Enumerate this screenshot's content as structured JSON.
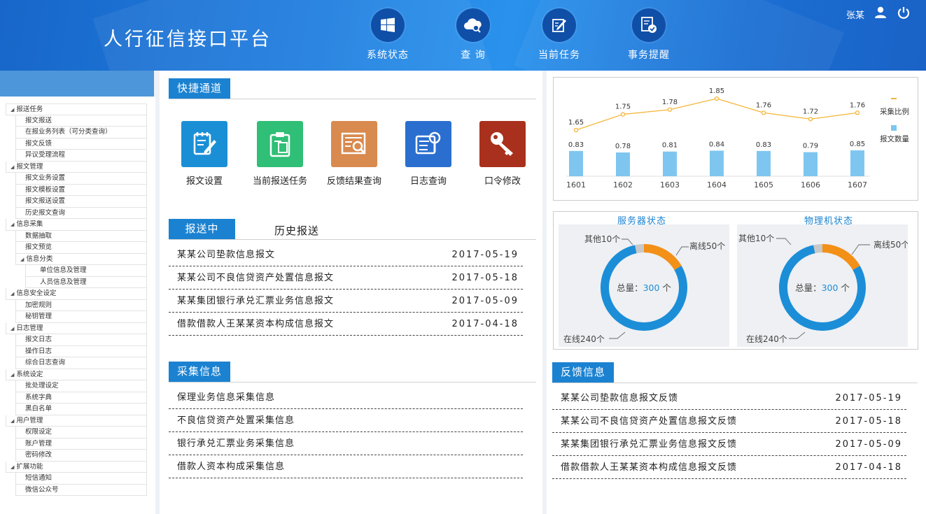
{
  "header": {
    "title": "人行征信接口平台",
    "nav": [
      {
        "label": "系统状态",
        "icon": "windows-icon"
      },
      {
        "label": "查 询",
        "icon": "cloud-search-icon"
      },
      {
        "label": "当前任务",
        "icon": "edit-document-icon"
      },
      {
        "label": "事务提醒",
        "icon": "clock-check-icon"
      }
    ],
    "user_name": "张某"
  },
  "sidebar": {
    "items": [
      {
        "label": "报送任务",
        "level": 0
      },
      {
        "label": "报文报送",
        "level": 1
      },
      {
        "label": "在报业务列表（可分类查询）",
        "level": 1
      },
      {
        "label": "报文反馈",
        "level": 1
      },
      {
        "label": "异议受理流程",
        "level": 1
      },
      {
        "label": "报文管理",
        "level": 0
      },
      {
        "label": "报文业务设置",
        "level": 1
      },
      {
        "label": "报文模板设置",
        "level": 1
      },
      {
        "label": "报文报送设置",
        "level": 1
      },
      {
        "label": "历史报文查询",
        "level": 1
      },
      {
        "label": "信息采集",
        "level": 0
      },
      {
        "label": "数据抽取",
        "level": 1
      },
      {
        "label": "报文预览",
        "level": 1
      },
      {
        "label": "信息分类",
        "level": 1,
        "group": true
      },
      {
        "label": "单位信息及管理",
        "level": 2
      },
      {
        "label": "人员信息及管理",
        "level": 2
      },
      {
        "label": "信息安全设定",
        "level": 0
      },
      {
        "label": "加密规则",
        "level": 1
      },
      {
        "label": "秘钥管理",
        "level": 1
      },
      {
        "label": "日志管理",
        "level": 0
      },
      {
        "label": "报文日志",
        "level": 1
      },
      {
        "label": "操作日志",
        "level": 1
      },
      {
        "label": "综合日志查询",
        "level": 1
      },
      {
        "label": "系统设定",
        "level": 0
      },
      {
        "label": "批处理设定",
        "level": 1
      },
      {
        "label": "系统字典",
        "level": 1
      },
      {
        "label": "黑白名单",
        "level": 1
      },
      {
        "label": "用户管理",
        "level": 0
      },
      {
        "label": "权限设定",
        "level": 1
      },
      {
        "label": "账户管理",
        "level": 1
      },
      {
        "label": "密码修改",
        "level": 1
      },
      {
        "label": "扩展功能",
        "level": 0
      },
      {
        "label": "短信通知",
        "level": 1
      },
      {
        "label": "微信公众号",
        "level": 1
      }
    ]
  },
  "quick": {
    "title": "快捷通道",
    "items": [
      {
        "label": "报文设置",
        "color": "#1b8fd6"
      },
      {
        "label": "当前报送任务",
        "color": "#2fbf76"
      },
      {
        "label": "反馈结果查询",
        "color": "#d98a4e"
      },
      {
        "label": "日志查询",
        "color": "#2a6fcf"
      },
      {
        "label": "口令修改",
        "color": "#a8301c"
      }
    ]
  },
  "reports": {
    "tab_active": "报送中",
    "tab_inactive": "历史报送",
    "rows": [
      {
        "text": "某某公司垫款信息报文",
        "date": "2017-05-19"
      },
      {
        "text": "某某公司不良信贷资产处置信息报文",
        "date": "2017-05-18"
      },
      {
        "text": "某某集团银行承兑汇票业务信息报文",
        "date": "2017-05-09"
      },
      {
        "text": "借款借款人王某某资本构成信息报文",
        "date": "2017-04-18"
      }
    ]
  },
  "collect": {
    "title": "采集信息",
    "rows": [
      "保理业务信息采集信息",
      "不良信贷资产处置采集信息",
      "银行承兑汇票业务采集信息",
      "借款人资本构成采集信息"
    ]
  },
  "feedback": {
    "title": "反馈信息",
    "rows": [
      {
        "text": "某某公司垫款信息报文反馈",
        "date": "2017-05-19"
      },
      {
        "text": "某某公司不良信贷资产处置信息报文反馈",
        "date": "2017-05-18"
      },
      {
        "text": "某某集团银行承兑汇票业务信息报文反馈",
        "date": "2017-05-09"
      },
      {
        "text": "借款借款人王某某资本构成信息报文反馈",
        "date": "2017-04-18"
      }
    ]
  },
  "chart_data": [
    {
      "type": "bar+line",
      "categories": [
        "1601",
        "1602",
        "1603",
        "1604",
        "1605",
        "1606",
        "1607"
      ],
      "series": [
        {
          "name": "采集比例",
          "type": "line",
          "values": [
            1.65,
            1.75,
            1.78,
            1.85,
            1.76,
            1.72,
            1.76
          ],
          "labels": [
            "1.65",
            "1.75",
            "1.78",
            "1.85",
            "1.76",
            "1.72",
            "1.76"
          ],
          "color": "#f5b534"
        },
        {
          "name": "报文数量",
          "type": "bar",
          "values": [
            0.83,
            0.78,
            0.81,
            0.84,
            0.83,
            0.79,
            0.85
          ],
          "labels": [
            "0.83",
            "0.78",
            "0.81",
            "0.84",
            "0.83",
            "0.79",
            "0.85"
          ],
          "color": "#7ec6f0"
        }
      ],
      "legend_position": "right"
    },
    {
      "type": "pie",
      "title": "服务器状态",
      "total_label": "总量：",
      "total_value": "300",
      "total_unit": " 个",
      "slices": [
        {
          "label": "离线50个",
          "value": 50,
          "color": "#f39017"
        },
        {
          "label": "在线240个",
          "value": 240,
          "color": "#1c8ed8"
        },
        {
          "label": "其他10个",
          "value": 10,
          "color": "#c8c8c8"
        }
      ]
    },
    {
      "type": "pie",
      "title": "物理机状态",
      "total_label": "总量：",
      "total_value": "300",
      "total_unit": " 个",
      "slices": [
        {
          "label": "离线50个",
          "value": 50,
          "color": "#f39017"
        },
        {
          "label": "在线240个",
          "value": 240,
          "color": "#1c8ed8"
        },
        {
          "label": "其他10个",
          "value": 10,
          "color": "#c8c8c8"
        }
      ]
    }
  ]
}
